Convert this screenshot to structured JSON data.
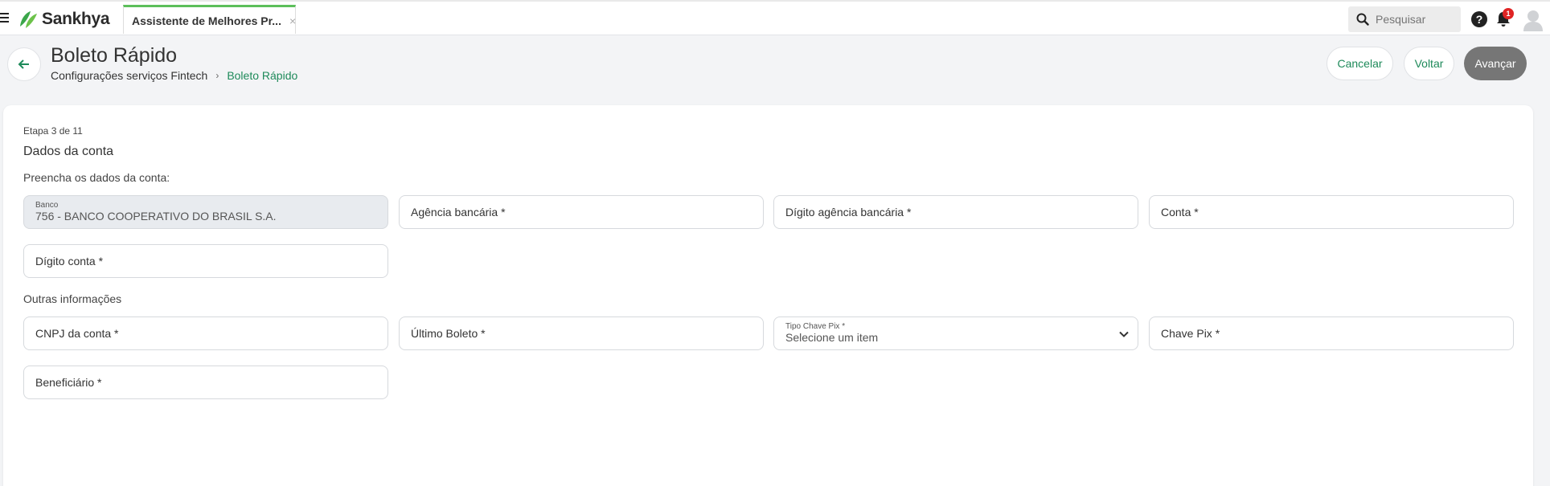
{
  "app": {
    "brand": "Sankhya",
    "tab_label": "Assistente de Melhores Pr...",
    "tab_close": "×",
    "search_placeholder": "Pesquisar",
    "help_symbol": "?",
    "notification_count": "1"
  },
  "header": {
    "title": "Boleto Rápido",
    "breadcrumb_parent": "Configurações serviços Fintech",
    "breadcrumb_separator": "›",
    "breadcrumb_current": "Boleto Rápido",
    "cancel_label": "Cancelar",
    "back_label": "Voltar",
    "next_label": "Avançar"
  },
  "form": {
    "step": "Etapa 3 de 11",
    "title": "Dados da conta",
    "instruction": "Preencha os dados da conta:",
    "other_info_label": "Outras informações",
    "banco_label": "Banco",
    "banco_value": "756 - BANCO COOPERATIVO DO BRASIL S.A.",
    "agencia_label": "Agência bancária *",
    "digito_agencia_label": "Dígito agência bancária *",
    "conta_label": "Conta *",
    "digito_conta_label": "Dígito conta *",
    "cnpj_label": "CNPJ da conta *",
    "ultimo_boleto_label": "Último Boleto *",
    "tipo_chave_pix_label": "Tipo Chave Pix *",
    "tipo_chave_pix_value": "Selecione um item",
    "chave_pix_label": "Chave Pix *",
    "beneficiario_label": "Beneficiário *"
  },
  "colors": {
    "accent_green": "#1e8a5a",
    "tab_indicator": "#5cbf5a",
    "primary_button": "#767676",
    "badge_red": "#e02424"
  }
}
